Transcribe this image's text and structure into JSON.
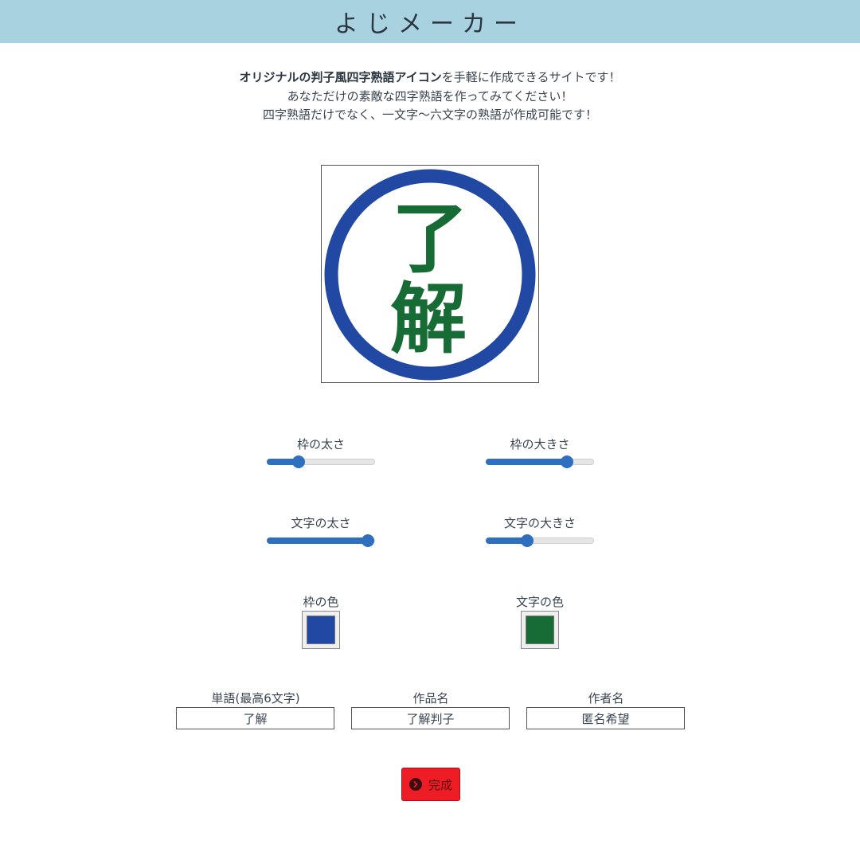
{
  "header": {
    "title": "よじメーカー"
  },
  "intro": {
    "line1_bold": "オリジナルの判子風四字熟語アイコン",
    "line1_rest": "を手軽に作成できるサイトです！",
    "line2": "あなただけの素敵な四字熟語を作ってみてください！",
    "line3": "四字熟語だけでなく、一文字〜六文字の熟語が作成可能です！"
  },
  "preview": {
    "characters": [
      "了",
      "解"
    ],
    "frame_color": "#2148a3",
    "text_color": "#176b34"
  },
  "controls": {
    "frame_thickness": {
      "label": "枠の太さ",
      "value": 0.29
    },
    "frame_size": {
      "label": "枠の大きさ",
      "value": 0.75
    },
    "text_weight": {
      "label": "文字の太さ",
      "value": 0.94
    },
    "text_size": {
      "label": "文字の大きさ",
      "value": 0.38
    },
    "frame_color": {
      "label": "枠の色",
      "value": "#2148a3"
    },
    "text_color": {
      "label": "文字の色",
      "value": "#176b34"
    }
  },
  "fields": {
    "word": {
      "label": "単語(最高6文字)",
      "value": "了解"
    },
    "title": {
      "label": "作品名",
      "value": "了解判子"
    },
    "author": {
      "label": "作者名",
      "value": "匿名希望"
    }
  },
  "actions": {
    "done_label": "完成",
    "done_icon": "chevron-circle-right-icon"
  }
}
